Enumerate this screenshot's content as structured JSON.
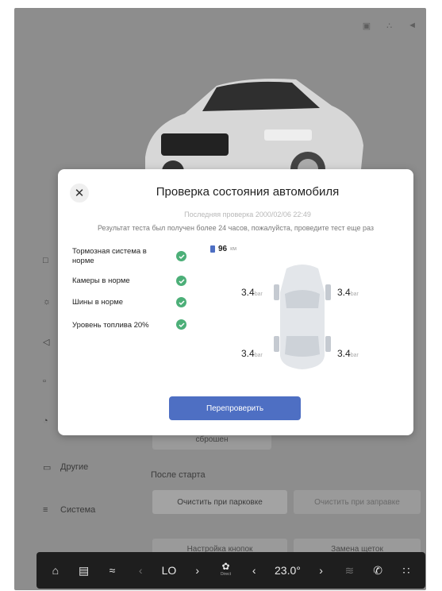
{
  "status_bar": {
    "icons": [
      "lock-icon",
      "signal-icon",
      "volume-icon"
    ]
  },
  "sidebar": {
    "items": [
      {
        "icon": "car-icon",
        "label": ""
      },
      {
        "icon": "light-icon",
        "label": ""
      },
      {
        "icon": "speaker-icon",
        "label": ""
      },
      {
        "icon": "seat-icon",
        "label": ""
      },
      {
        "icon": "gauge-icon",
        "label": ""
      },
      {
        "icon": "car-outline-icon",
        "label": "Другие"
      },
      {
        "icon": "sliders-icon",
        "label": "Система"
      }
    ]
  },
  "background": {
    "reset_button": "сброшен",
    "after_start_label": "После старта",
    "clear_parking": "Очистить при парковке",
    "clear_refuel": "Очистить при заправке",
    "button_settings": "Настройка кнопок",
    "replace_brushes": "Замена щеток"
  },
  "modal": {
    "title": "Проверка состояния автомобиля",
    "last_check": "Последняя проверка 2000/02/06 22:49",
    "note": "Результат теста был получен более 24 часов, пожалуйста, проведите тест еще раз",
    "checks": [
      {
        "label": "Тормозная система в норме"
      },
      {
        "label": "Камеры в норме"
      },
      {
        "label": "Шины в норме"
      },
      {
        "label": "Уровень топлива 20%"
      }
    ],
    "range_value": "96",
    "range_unit": "км",
    "tires": {
      "front_left": "3.4",
      "front_right": "3.4",
      "rear_left": "3.4",
      "rear_right": "3.4",
      "unit": "bar"
    },
    "recheck_button": "Перепроверить"
  },
  "taskbar": {
    "ac_label": "LO",
    "temp": "23.0°",
    "fan_label": "Direct"
  }
}
